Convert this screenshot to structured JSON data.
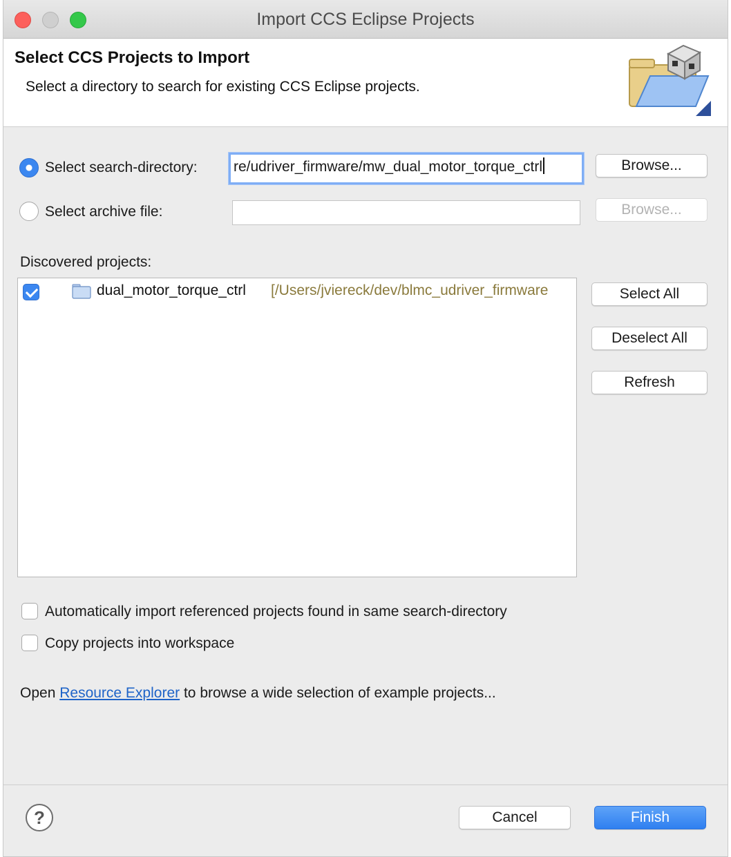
{
  "window": {
    "title": "Import CCS Eclipse Projects"
  },
  "banner": {
    "title": "Select CCS Projects to Import",
    "description": "Select a directory to search for existing CCS Eclipse projects."
  },
  "search_directory": {
    "label": "Select search-directory:",
    "value": "re/udriver_firmware/mw_dual_motor_torque_ctrl",
    "selected": true,
    "browse_label": "Browse..."
  },
  "archive_file": {
    "label": "Select archive file:",
    "value": "",
    "selected": false,
    "browse_label": "Browse..."
  },
  "discovered": {
    "label": "Discovered projects:",
    "projects": [
      {
        "name": "dual_motor_torque_ctrl",
        "path": "[/Users/jviereck/dev/blmc_udriver_firmware",
        "checked": true
      }
    ]
  },
  "side_buttons": {
    "select_all": "Select All",
    "deselect_all": "Deselect All",
    "refresh": "Refresh"
  },
  "options": {
    "auto_import": {
      "label": "Automatically import referenced projects found in same search-directory",
      "checked": false
    },
    "copy_workspace": {
      "label": "Copy projects into workspace",
      "checked": false
    }
  },
  "resource": {
    "prefix": "Open",
    "link": "Resource Explorer",
    "suffix": "to browse a wide selection of example projects..."
  },
  "footer": {
    "help_icon": "help-icon",
    "cancel": "Cancel",
    "finish": "Finish"
  },
  "colors": {
    "accent": "#3b87f0",
    "path_text": "#8a7a3c",
    "link": "#1e63c8"
  }
}
